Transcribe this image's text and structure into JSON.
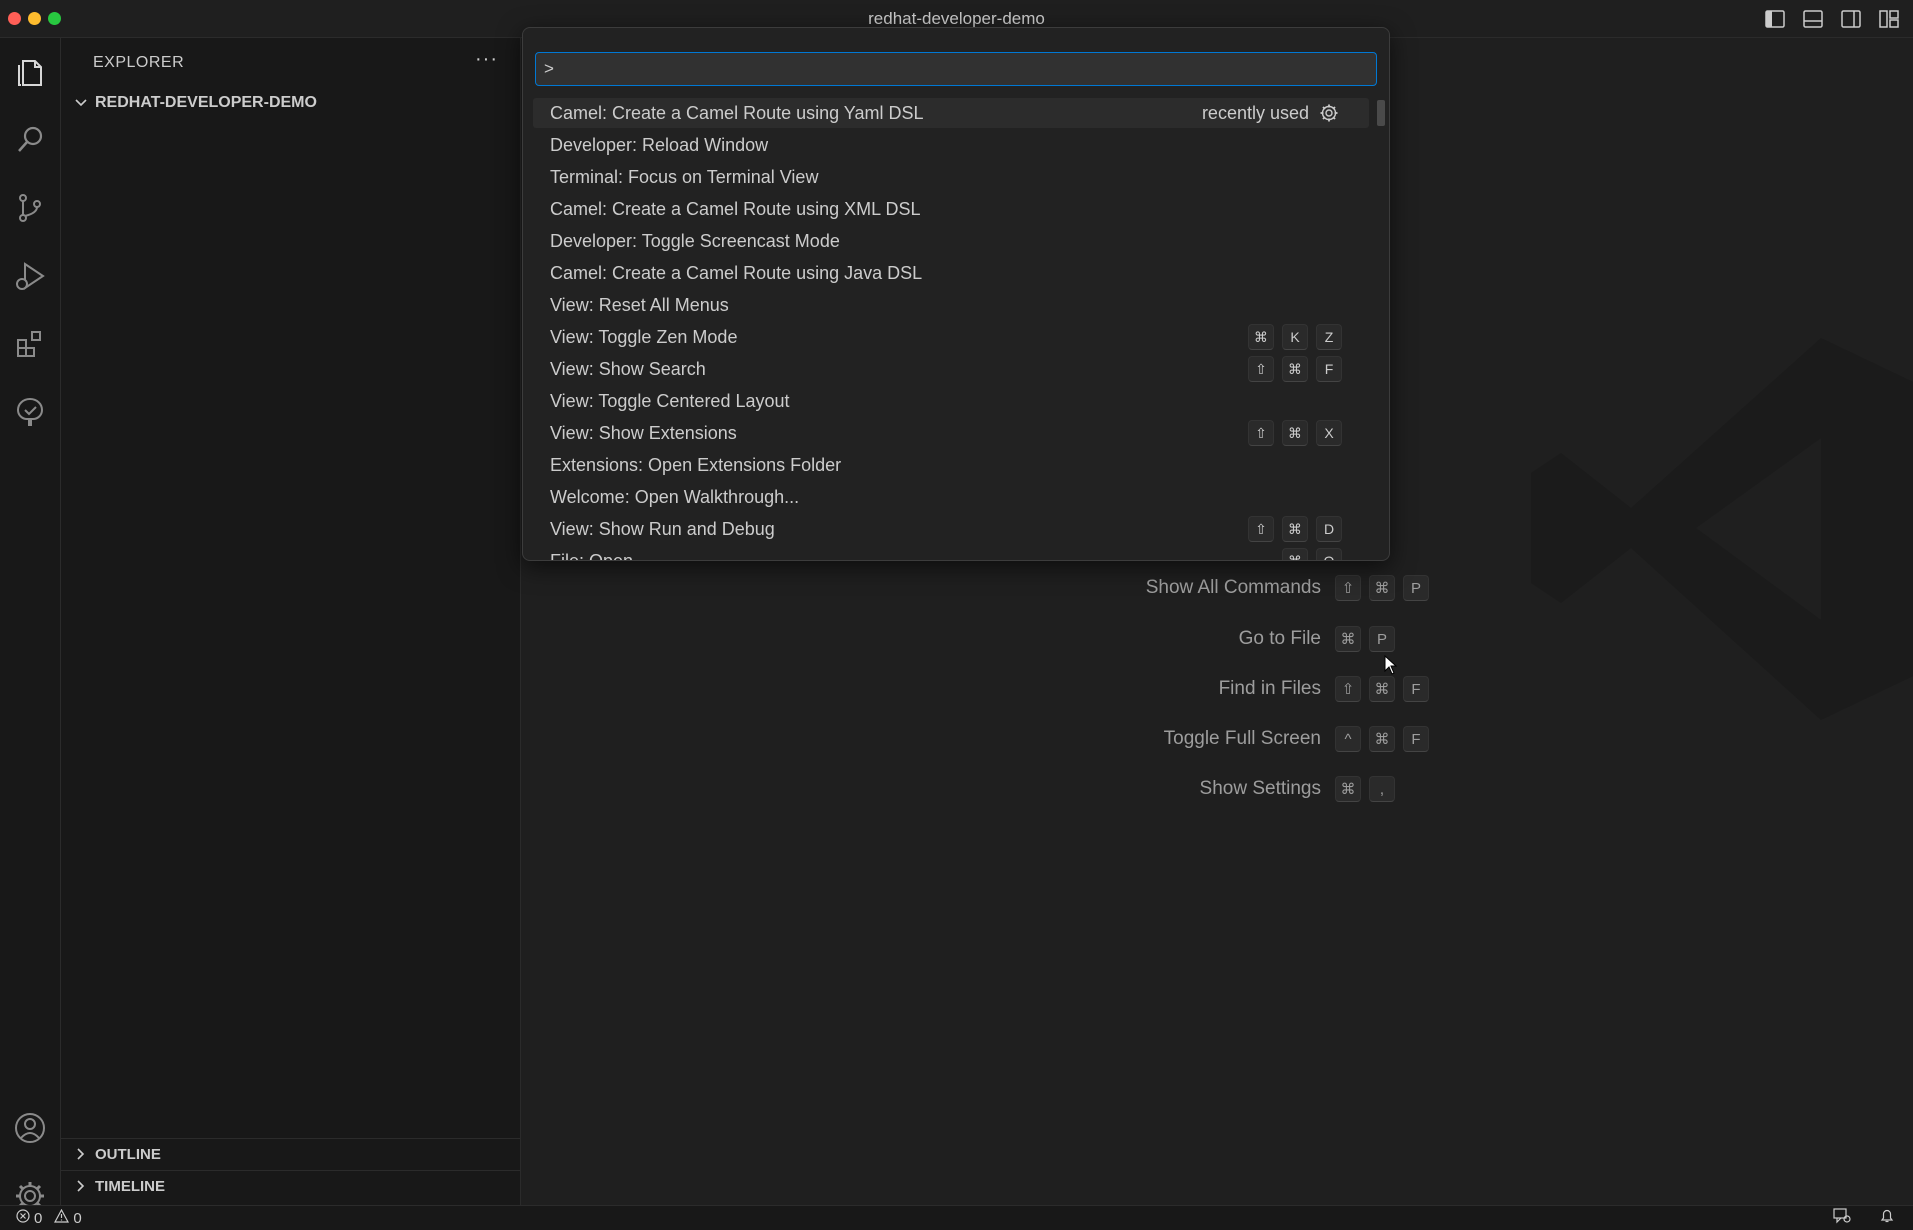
{
  "window": {
    "title": "redhat-developer-demo"
  },
  "activity_bar": {
    "items": [
      "explorer-icon",
      "search-icon",
      "source-control-icon",
      "run-debug-icon",
      "extensions-icon",
      "openshift-icon"
    ],
    "bottom": [
      "account-icon",
      "manage-gear-icon"
    ]
  },
  "sidebar": {
    "title": "EXPLORER",
    "more": "···",
    "folder": "REDHAT-DEVELOPER-DEMO",
    "outline": "OUTLINE",
    "timeline": "TIMELINE"
  },
  "palette": {
    "input_value": ">",
    "items": [
      {
        "label": "Camel: Create a Camel Route using Yaml DSL",
        "meta": "recently used",
        "keys": []
      },
      {
        "label": "Developer: Reload Window",
        "keys": []
      },
      {
        "label": "Terminal: Focus on Terminal View",
        "keys": []
      },
      {
        "label": "Camel: Create a Camel Route using XML DSL",
        "keys": []
      },
      {
        "label": "Developer: Toggle Screencast Mode",
        "keys": []
      },
      {
        "label": "Camel: Create a Camel Route using Java DSL",
        "keys": []
      },
      {
        "label": "View: Reset All Menus",
        "keys": []
      },
      {
        "label": "View: Toggle Zen Mode",
        "keys": [
          "⌘",
          "K",
          "Z"
        ]
      },
      {
        "label": "View: Show Search",
        "keys": [
          "⇧",
          "⌘",
          "F"
        ]
      },
      {
        "label": "View: Toggle Centered Layout",
        "keys": []
      },
      {
        "label": "View: Show Extensions",
        "keys": [
          "⇧",
          "⌘",
          "X"
        ]
      },
      {
        "label": "Extensions: Open Extensions Folder",
        "keys": []
      },
      {
        "label": "Welcome: Open Walkthrough...",
        "keys": []
      },
      {
        "label": "View: Show Run and Debug",
        "keys": [
          "⇧",
          "⌘",
          "D"
        ]
      },
      {
        "label": "File: Open...",
        "keys": [
          "⌘",
          "O"
        ]
      }
    ]
  },
  "shortcuts": [
    {
      "label": "Show All Commands",
      "keys": [
        "⇧",
        "⌘",
        "P"
      ]
    },
    {
      "label": "Go to File",
      "keys": [
        "⌘",
        "P"
      ]
    },
    {
      "label": "Find in Files",
      "keys": [
        "⇧",
        "⌘",
        "F"
      ]
    },
    {
      "label": "Toggle Full Screen",
      "keys": [
        "^",
        "⌘",
        "F"
      ]
    },
    {
      "label": "Show Settings",
      "keys": [
        "⌘",
        ","
      ]
    }
  ],
  "status": {
    "errors": "0",
    "warnings": "0"
  },
  "colors": {
    "accent": "#0078d4",
    "background": "#1f1f1f",
    "sidebar": "#181818"
  }
}
